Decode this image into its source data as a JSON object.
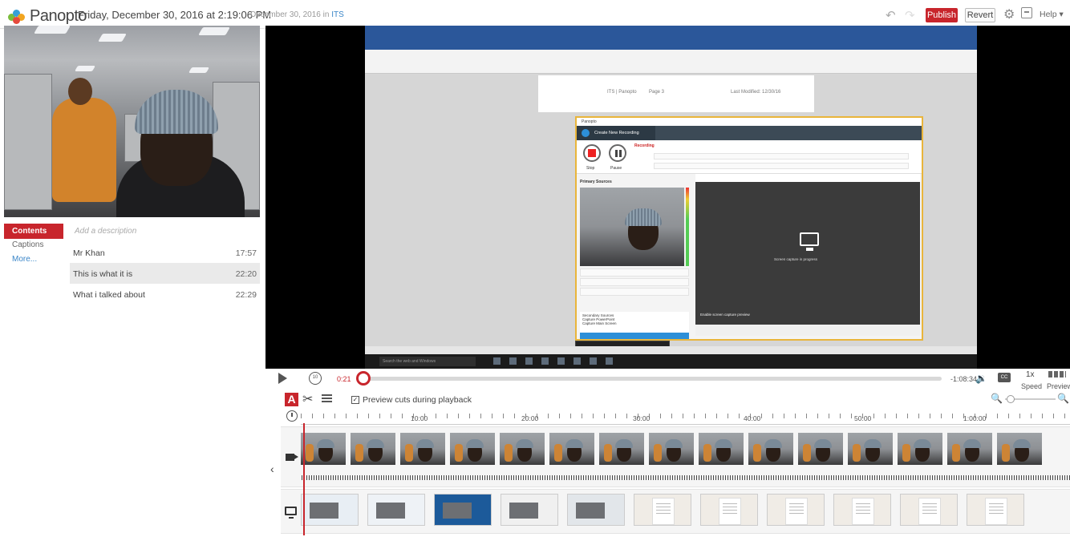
{
  "header": {
    "logo_text": "Panopto",
    "recording_title": "Friday, December 30, 2016 at 2:19:06 PM",
    "folder_prefix": "December 30, 2016 in",
    "folder_name": "ITS",
    "publish_label": "Publish",
    "revert_label": "Revert",
    "help_label": "Help"
  },
  "left_panel": {
    "tabs": [
      {
        "label": "Contents"
      },
      {
        "label": "Captions"
      },
      {
        "label": "More..."
      }
    ],
    "description_placeholder": "Add a description",
    "toc": [
      {
        "title": "Mr Khan",
        "time": "17:57"
      },
      {
        "title": "This is what it is",
        "time": "22:20"
      },
      {
        "title": "What i talked about",
        "time": "22:29"
      }
    ]
  },
  "player": {
    "elapsed": "0:21",
    "remaining": "-1:08:34",
    "rewind_label": "10",
    "cc_label": "CC",
    "speed_value": "1x",
    "speed_label": "Speed",
    "preview_label": "Preview",
    "progress_fraction": 0.003
  },
  "editor": {
    "preview_cuts_label": "Preview cuts during playback",
    "preview_cuts_checked": true,
    "ruler_ticks": [
      "10:00",
      "20:00",
      "30:00",
      "40:00",
      "50:00",
      "1:00:00"
    ]
  },
  "screen_capture": {
    "doc_header_left": "ITS | Panopto",
    "doc_header_mid": "Page 3",
    "doc_header_right": "Last Modified: 12/30/16",
    "recorder_tab": "Create New Recording",
    "recording_status": "Recording",
    "stop_label": "Stop",
    "pause_label": "Pause",
    "primary_sources_label": "Primary Sources",
    "secondary_sources_label": "Secondary Sources",
    "capture_powerpoint": "Capture PowerPoint",
    "capture_main_screen": "Capture Main Screen",
    "add_video_source": "Add Another Video Source",
    "screen_capture_text": "Screen capture in progress",
    "enable_preview": "Enable screen capture preview",
    "taskbar_search": "Search the web and Windows"
  },
  "colors": {
    "accent": "#c8252c",
    "link": "#3a86c8",
    "recorder_border": "#e9b53b"
  }
}
